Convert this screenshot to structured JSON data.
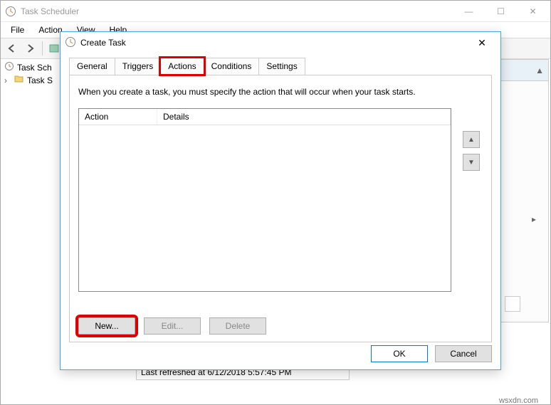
{
  "main_window": {
    "title": "Task Scheduler",
    "menu": {
      "file": "File",
      "action": "Action",
      "view": "View",
      "help": "Help"
    },
    "tree": {
      "root": "Task Scheduler (Local)",
      "child": "Task Scheduler Library"
    },
    "status": "Last refreshed at 6/12/2018 5:57:45 PM"
  },
  "dialog": {
    "title": "Create Task",
    "tabs": {
      "general": "General",
      "triggers": "Triggers",
      "actions": "Actions",
      "conditions": "Conditions",
      "settings": "Settings"
    },
    "instruction": "When you create a task, you must specify the action that will occur when your task starts.",
    "columns": {
      "action": "Action",
      "details": "Details"
    },
    "buttons": {
      "new": "New...",
      "edit": "Edit...",
      "delete": "Delete",
      "ok": "OK",
      "cancel": "Cancel"
    }
  },
  "watermark": "wsxdn.com"
}
